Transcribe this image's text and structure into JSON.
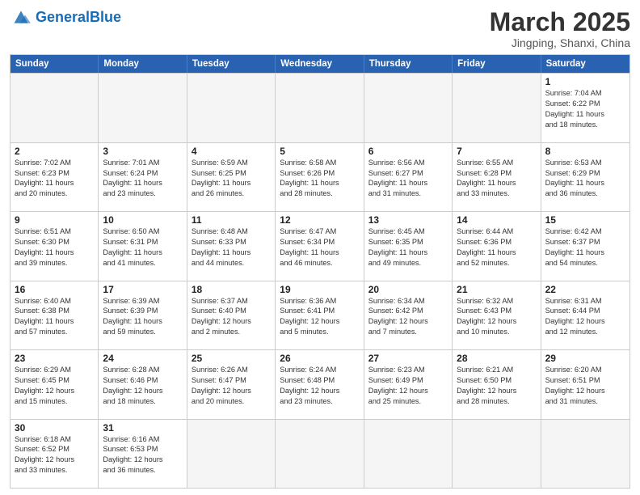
{
  "header": {
    "logo_general": "General",
    "logo_blue": "Blue",
    "title": "March 2025",
    "subtitle": "Jingping, Shanxi, China"
  },
  "days_of_week": [
    "Sunday",
    "Monday",
    "Tuesday",
    "Wednesday",
    "Thursday",
    "Friday",
    "Saturday"
  ],
  "rows": [
    [
      {
        "day": "",
        "info": ""
      },
      {
        "day": "",
        "info": ""
      },
      {
        "day": "",
        "info": ""
      },
      {
        "day": "",
        "info": ""
      },
      {
        "day": "",
        "info": ""
      },
      {
        "day": "",
        "info": ""
      },
      {
        "day": "1",
        "info": "Sunrise: 7:04 AM\nSunset: 6:22 PM\nDaylight: 11 hours\nand 18 minutes."
      }
    ],
    [
      {
        "day": "2",
        "info": "Sunrise: 7:02 AM\nSunset: 6:23 PM\nDaylight: 11 hours\nand 20 minutes."
      },
      {
        "day": "3",
        "info": "Sunrise: 7:01 AM\nSunset: 6:24 PM\nDaylight: 11 hours\nand 23 minutes."
      },
      {
        "day": "4",
        "info": "Sunrise: 6:59 AM\nSunset: 6:25 PM\nDaylight: 11 hours\nand 26 minutes."
      },
      {
        "day": "5",
        "info": "Sunrise: 6:58 AM\nSunset: 6:26 PM\nDaylight: 11 hours\nand 28 minutes."
      },
      {
        "day": "6",
        "info": "Sunrise: 6:56 AM\nSunset: 6:27 PM\nDaylight: 11 hours\nand 31 minutes."
      },
      {
        "day": "7",
        "info": "Sunrise: 6:55 AM\nSunset: 6:28 PM\nDaylight: 11 hours\nand 33 minutes."
      },
      {
        "day": "8",
        "info": "Sunrise: 6:53 AM\nSunset: 6:29 PM\nDaylight: 11 hours\nand 36 minutes."
      }
    ],
    [
      {
        "day": "9",
        "info": "Sunrise: 6:51 AM\nSunset: 6:30 PM\nDaylight: 11 hours\nand 39 minutes."
      },
      {
        "day": "10",
        "info": "Sunrise: 6:50 AM\nSunset: 6:31 PM\nDaylight: 11 hours\nand 41 minutes."
      },
      {
        "day": "11",
        "info": "Sunrise: 6:48 AM\nSunset: 6:33 PM\nDaylight: 11 hours\nand 44 minutes."
      },
      {
        "day": "12",
        "info": "Sunrise: 6:47 AM\nSunset: 6:34 PM\nDaylight: 11 hours\nand 46 minutes."
      },
      {
        "day": "13",
        "info": "Sunrise: 6:45 AM\nSunset: 6:35 PM\nDaylight: 11 hours\nand 49 minutes."
      },
      {
        "day": "14",
        "info": "Sunrise: 6:44 AM\nSunset: 6:36 PM\nDaylight: 11 hours\nand 52 minutes."
      },
      {
        "day": "15",
        "info": "Sunrise: 6:42 AM\nSunset: 6:37 PM\nDaylight: 11 hours\nand 54 minutes."
      }
    ],
    [
      {
        "day": "16",
        "info": "Sunrise: 6:40 AM\nSunset: 6:38 PM\nDaylight: 11 hours\nand 57 minutes."
      },
      {
        "day": "17",
        "info": "Sunrise: 6:39 AM\nSunset: 6:39 PM\nDaylight: 11 hours\nand 59 minutes."
      },
      {
        "day": "18",
        "info": "Sunrise: 6:37 AM\nSunset: 6:40 PM\nDaylight: 12 hours\nand 2 minutes."
      },
      {
        "day": "19",
        "info": "Sunrise: 6:36 AM\nSunset: 6:41 PM\nDaylight: 12 hours\nand 5 minutes."
      },
      {
        "day": "20",
        "info": "Sunrise: 6:34 AM\nSunset: 6:42 PM\nDaylight: 12 hours\nand 7 minutes."
      },
      {
        "day": "21",
        "info": "Sunrise: 6:32 AM\nSunset: 6:43 PM\nDaylight: 12 hours\nand 10 minutes."
      },
      {
        "day": "22",
        "info": "Sunrise: 6:31 AM\nSunset: 6:44 PM\nDaylight: 12 hours\nand 12 minutes."
      }
    ],
    [
      {
        "day": "23",
        "info": "Sunrise: 6:29 AM\nSunset: 6:45 PM\nDaylight: 12 hours\nand 15 minutes."
      },
      {
        "day": "24",
        "info": "Sunrise: 6:28 AM\nSunset: 6:46 PM\nDaylight: 12 hours\nand 18 minutes."
      },
      {
        "day": "25",
        "info": "Sunrise: 6:26 AM\nSunset: 6:47 PM\nDaylight: 12 hours\nand 20 minutes."
      },
      {
        "day": "26",
        "info": "Sunrise: 6:24 AM\nSunset: 6:48 PM\nDaylight: 12 hours\nand 23 minutes."
      },
      {
        "day": "27",
        "info": "Sunrise: 6:23 AM\nSunset: 6:49 PM\nDaylight: 12 hours\nand 25 minutes."
      },
      {
        "day": "28",
        "info": "Sunrise: 6:21 AM\nSunset: 6:50 PM\nDaylight: 12 hours\nand 28 minutes."
      },
      {
        "day": "29",
        "info": "Sunrise: 6:20 AM\nSunset: 6:51 PM\nDaylight: 12 hours\nand 31 minutes."
      }
    ],
    [
      {
        "day": "30",
        "info": "Sunrise: 6:18 AM\nSunset: 6:52 PM\nDaylight: 12 hours\nand 33 minutes."
      },
      {
        "day": "31",
        "info": "Sunrise: 6:16 AM\nSunset: 6:53 PM\nDaylight: 12 hours\nand 36 minutes."
      },
      {
        "day": "",
        "info": ""
      },
      {
        "day": "",
        "info": ""
      },
      {
        "day": "",
        "info": ""
      },
      {
        "day": "",
        "info": ""
      },
      {
        "day": "",
        "info": ""
      }
    ]
  ]
}
